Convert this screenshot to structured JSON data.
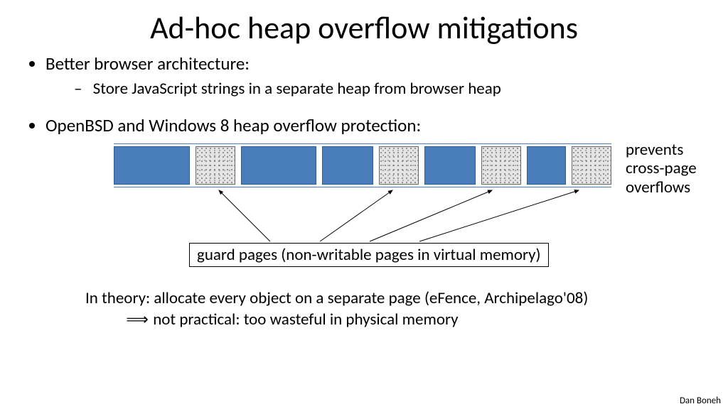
{
  "title": "Ad-hoc heap overflow mitigations",
  "bullets": {
    "b1": "Better browser architecture:",
    "b1sub": "Store JavaScript strings in a separate heap from browser heap",
    "b2": "OpenBSD and Windows 8 heap overflow protection:"
  },
  "diagram": {
    "side_label_l1": "prevents",
    "side_label_l2": "cross-page",
    "side_label_l3": "overflows",
    "guard_box": "guard  pages (non-writable pages in virtual memory)"
  },
  "theory": {
    "line1": "In theory:  allocate every object on a separate page  (eFence, Archipelago'08)",
    "line2": "not practical:  too wasteful in physical memory"
  },
  "author": "Dan Boneh"
}
